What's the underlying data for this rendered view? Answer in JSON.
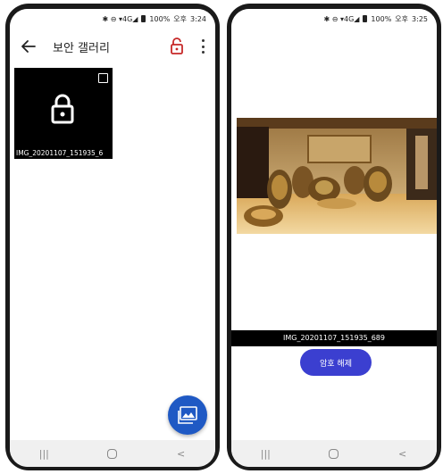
{
  "left_phone": {
    "status": {
      "icons": "✱ ⊖ ▾4G◢",
      "battery": "100%",
      "ampm": "오후",
      "time": "3:24"
    },
    "toolbar": {
      "title": "보안 갤러리"
    },
    "gallery": {
      "items": [
        {
          "label": "IMG_20201107_151935_6"
        }
      ]
    },
    "nav": {
      "recents": "|||",
      "back": "<"
    }
  },
  "right_phone": {
    "status": {
      "icons": "✱ ⊖ ▾4G◢",
      "battery": "100%",
      "ampm": "오후",
      "time": "3:25"
    },
    "viewer": {
      "filename": "IMG_20201107_151935_689",
      "decrypt_label": "암호 해제"
    },
    "nav": {
      "recents": "|||",
      "back": "<"
    }
  },
  "colors": {
    "accent_red": "#c62828",
    "fab_blue": "#1f59c4",
    "button_blue": "#3b3fd0"
  },
  "icons": {
    "back": "arrow-left-icon",
    "unlock": "lock-open-icon",
    "more": "more-vert-icon",
    "locked_item": "lock-icon",
    "fab": "image-icon"
  }
}
